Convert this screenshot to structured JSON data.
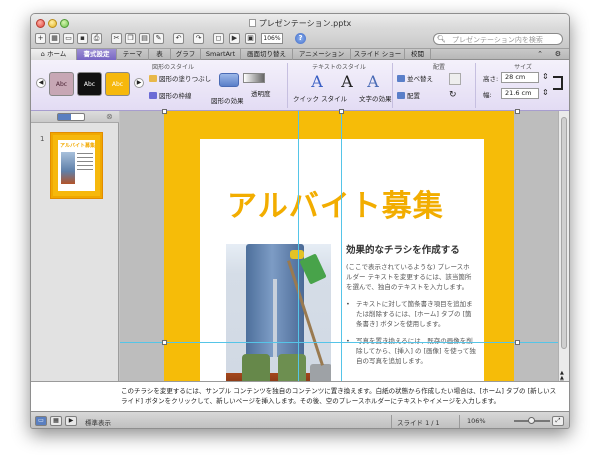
{
  "window": {
    "title": "プレゼンテーション.pptx"
  },
  "toolbar": {
    "zoom": "106%",
    "search_placeholder": "プレゼンテーション内を検索"
  },
  "tabs": [
    {
      "label": "ホーム"
    },
    {
      "label": "書式設定"
    },
    {
      "label": "テーマ"
    },
    {
      "label": "表"
    },
    {
      "label": "グラフ"
    },
    {
      "label": "SmartArt"
    },
    {
      "label": "画面切り替え"
    },
    {
      "label": "アニメーション"
    },
    {
      "label": "スライド ショー"
    },
    {
      "label": "校閲"
    }
  ],
  "ribbon": {
    "groups": {
      "shape_styles": "図形のスタイル",
      "text_styles": "テキストのスタイル",
      "arrange": "配置",
      "size": "サイズ"
    },
    "swatches": [
      {
        "label": "Abc",
        "bg": "#c7a7b5",
        "fg": "#4a2233"
      },
      {
        "label": "Abc",
        "bg": "#111111",
        "fg": "#ffffff"
      },
      {
        "label": "Abc",
        "bg": "#f6b80c",
        "fg": "#ffffff"
      }
    ],
    "shape_fill": "図形の塗りつぶし",
    "shape_outline": "図形の枠線",
    "shape_effects": "図形の効果",
    "transparency": "透明度",
    "quick_styles": "クイック スタイル",
    "text_effects": "文字の効果",
    "reorder": "並べ替え",
    "align": "配置",
    "height_label": "高さ:",
    "height_value": "28 cm",
    "width_label": "幅:",
    "width_value": "21.6 cm"
  },
  "sidebar": {
    "slide_number": "1",
    "thumb_title": "アルバイト募集"
  },
  "slide": {
    "headline": "アルバイト募集",
    "subhead": "効果的なチラシを作成する",
    "paragraph": "(ここで表示されているような) プレースホルダー テキストを変更するには、該当箇所を選んで、独自のテキストを入力します。",
    "bullets": [
      "テキストに対して箇条書き項目を追加または削除するには、[ホーム] タブの [箇条書き] ボタンを使用します。",
      "写真を置き換えるには、既存の画像を削除してから、[挿入] の [画像] を使って独自の写真を追加します。"
    ]
  },
  "notes": {
    "text": "このチラシを変更するには、サンプル コンテンツを独自のコンテンツに置き換えます。白紙の状態から作成したい場合は、[ホーム] タブの [新しいスライド] ボタンをクリックして、新しいページを挿入します。その後、空のプレースホルダーにテキストやイメージを入力します。"
  },
  "status": {
    "view_label": "標準表示",
    "slide_position": "スライド 1 / 1",
    "zoom": "106%"
  }
}
